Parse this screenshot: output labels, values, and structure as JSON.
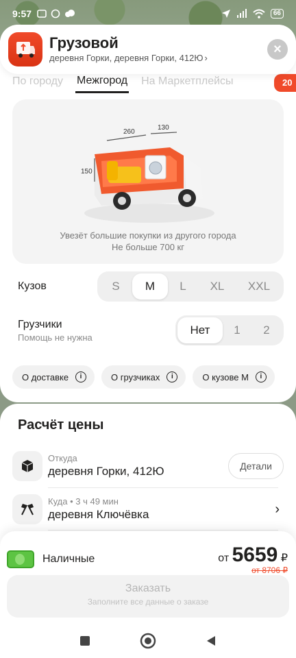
{
  "status_bar": {
    "time": "9:57",
    "battery": "66",
    "map_label": "деревня Горки"
  },
  "header": {
    "title": "Грузовой",
    "subtitle": "деревня Горки, деревня Горки, 412Ю",
    "accent_color": "#f04a2a"
  },
  "tabs": [
    {
      "label": "По городу",
      "active": false
    },
    {
      "label": "Межгород",
      "active": true
    },
    {
      "label": "На Маркетплейсы",
      "active": false
    }
  ],
  "tab_badge": "20",
  "illustration": {
    "length": "260",
    "width": "130",
    "height": "150",
    "line1": "Увезёт большие покупки из другого города",
    "line2": "Не больше 700 кг"
  },
  "body_option": {
    "label": "Кузов",
    "sizes": [
      "S",
      "M",
      "L",
      "XL",
      "XXL"
    ],
    "selected": "M"
  },
  "loaders_option": {
    "label": "Грузчики",
    "sublabel": "Помощь не нужна",
    "choices": [
      "Нет",
      "1",
      "2"
    ],
    "selected": "Нет"
  },
  "info_chips": [
    "О доставке",
    "О грузчиках",
    "О кузове M"
  ],
  "price_section": {
    "title": "Расчёт цены",
    "from": {
      "caption": "Откуда",
      "value": "деревня Горки, 412Ю",
      "button": "Детали"
    },
    "to": {
      "caption": "Куда • 3 ч 49 мин",
      "value": "деревня Ключёвка"
    }
  },
  "payment": {
    "method": "Наличные",
    "price_prefix": "от",
    "price": "5659",
    "currency": "₽",
    "old_price": "от 8706 ₽"
  },
  "order_button": {
    "label": "Заказать",
    "hint": "Заполните все данные о заказе"
  }
}
